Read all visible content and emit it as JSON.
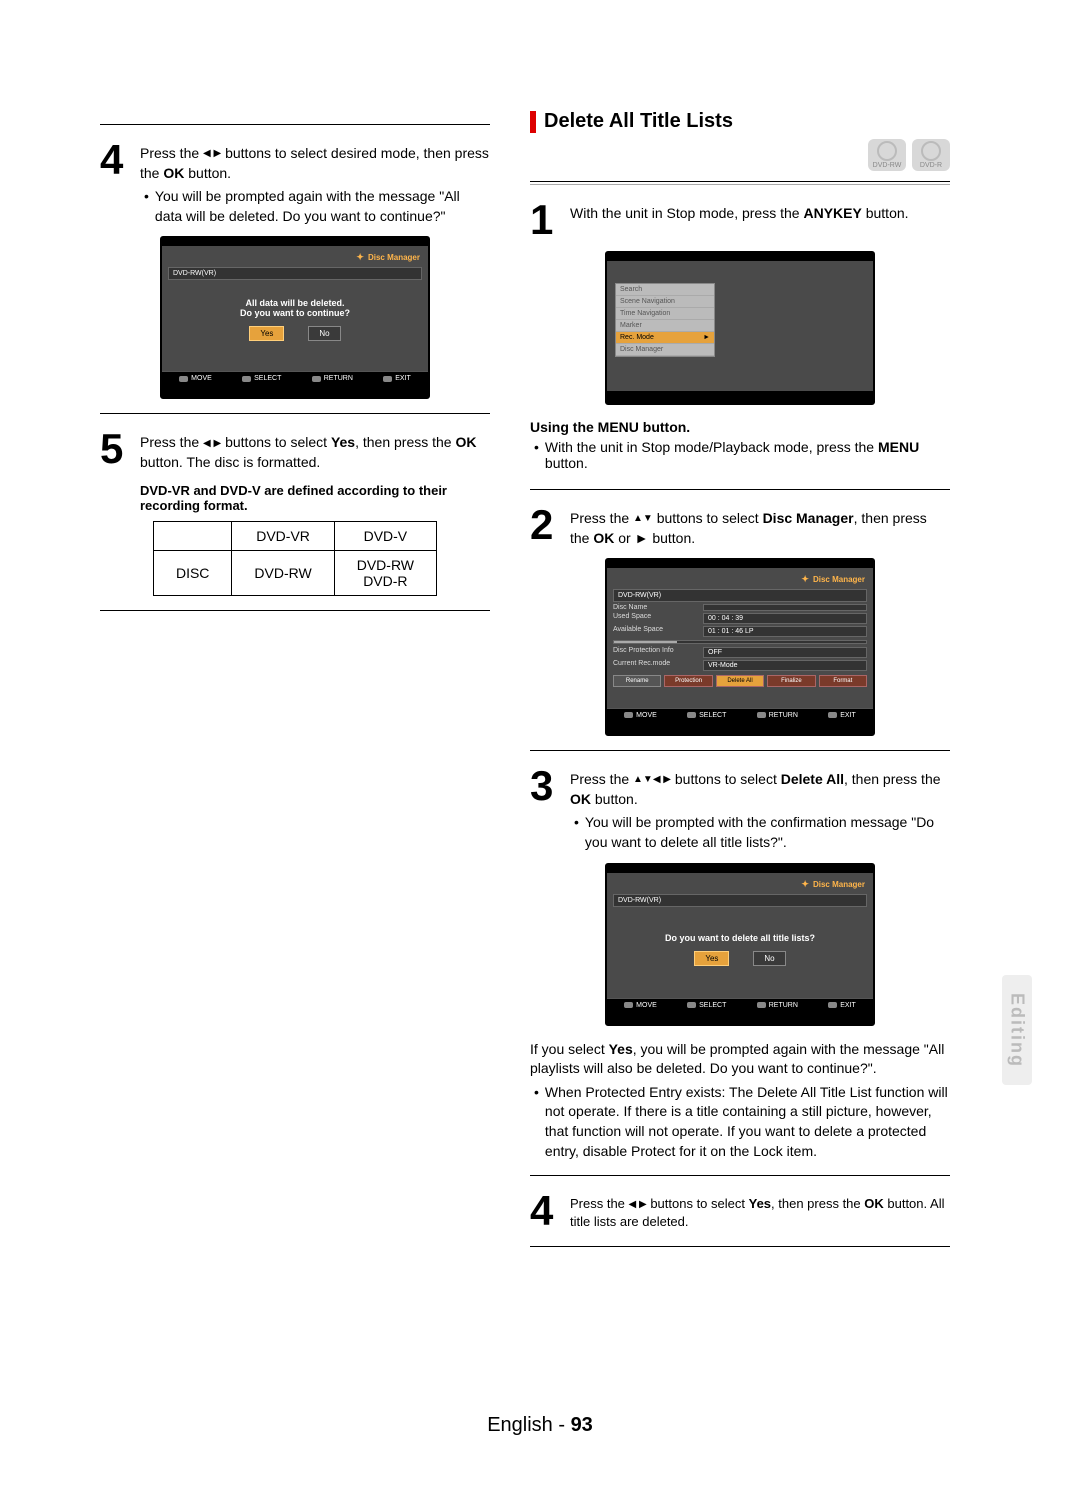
{
  "section_title": "Delete All Title Lists",
  "badges": [
    "DVD-RW",
    "DVD-R"
  ],
  "left": {
    "step4": {
      "num": "4",
      "text_a": "Press the ",
      "text_b": " buttons to select desired mode, then press the ",
      "ok": "OK",
      "text_c": " button.",
      "bullet": "You will be prompted again with the message \"All data will be deleted. Do you want to continue?\""
    },
    "osd1": {
      "title": "Disc Manager",
      "sub": "DVD-RW(VR)",
      "line1": "All data will be deleted.",
      "line2": "Do you want to continue?",
      "yes": "Yes",
      "no": "No",
      "foot": [
        "MOVE",
        "SELECT",
        "RETURN",
        "EXIT"
      ]
    },
    "step5": {
      "num": "5",
      "text_a": "Press the ",
      "text_b": " buttons to select ",
      "yes": "Yes",
      "text_c": ", then press the ",
      "ok": "OK",
      "text_d": " button. The disc is formatted."
    },
    "note": "DVD-VR and DVD-V are defined according to their recording format.",
    "table": {
      "h1": "DVD-VR",
      "h2": "DVD-V",
      "r1": "DISC",
      "c1": "DVD-RW",
      "c2a": "DVD-RW",
      "c2b": "DVD-R"
    }
  },
  "right": {
    "step1": {
      "num": "1",
      "text_a": "With the unit in Stop mode, press the ",
      "anykey": "ANYKEY",
      "text_b": " button."
    },
    "osd_menu": {
      "items": [
        "Search",
        "Scene Navigation",
        "Time Navigation",
        "Marker",
        "Rec. Mode",
        "Disc Manager"
      ],
      "hl_index": 4,
      "arrow": "►"
    },
    "using_menu_heading": "Using the MENU button.",
    "using_menu_bullet_a": "With the unit in Stop mode/Playback mode, press the ",
    "using_menu_bold": "MENU",
    "using_menu_bullet_b": " button.",
    "step2": {
      "num": "2",
      "text_a": "Press the ",
      "text_b": " buttons to select ",
      "dm": "Disc Manager",
      "text_c": ", then press the ",
      "ok": "OK",
      "text_d": " or ► button."
    },
    "osd_dm": {
      "title": "Disc Manager",
      "sub": "DVD-RW(VR)",
      "rows": [
        {
          "lab": "Disc Name",
          "val": ""
        },
        {
          "lab": "Used Space",
          "val": "00 : 04 : 39"
        },
        {
          "lab": "Available Space",
          "val": "01 : 01 : 46 LP"
        }
      ],
      "rows2": [
        {
          "lab": "Disc Protection Info",
          "val": "OFF"
        },
        {
          "lab": "Current Rec.mode",
          "val": "VR-Mode"
        }
      ],
      "btns": [
        "Rename",
        "Protection",
        "Delete All",
        "Finalize",
        "Format"
      ],
      "foot": [
        "MOVE",
        "SELECT",
        "RETURN",
        "EXIT"
      ]
    },
    "step3": {
      "num": "3",
      "text_a": "Press the ",
      "text_b": " buttons to select ",
      "da": "Delete All",
      "text_c": ", then press the ",
      "ok": "OK",
      "text_d": " button.",
      "bullet": "You will be prompted with the confirmation message \"Do you want to delete all title lists?\"."
    },
    "osd3": {
      "title": "Disc Manager",
      "sub": "DVD-RW(VR)",
      "line": "Do you want to delete all title lists?",
      "yes": "Yes",
      "no": "No",
      "foot": [
        "MOVE",
        "SELECT",
        "RETURN",
        "EXIT"
      ]
    },
    "post3_a": "If you select ",
    "post3_yes": "Yes",
    "post3_b": ", you will be prompted again with the message \"All playlists will also be deleted. Do you want to continue?\".",
    "post3_bullet": "When Protected Entry exists: The Delete All Title List function will not operate. If there is a title containing a still picture, however, that function will not operate. If you want to delete a protected entry, disable Protect for it on the Lock item.",
    "step4r": {
      "num": "4",
      "text_a": "Press the ",
      "text_b": " buttons to select ",
      "yes": "Yes",
      "text_c": ", then press the ",
      "ok": "OK",
      "text_d": " button. All title lists are deleted."
    }
  },
  "sidetab": "Editing",
  "footer": {
    "lang": "English - ",
    "page": "93"
  }
}
